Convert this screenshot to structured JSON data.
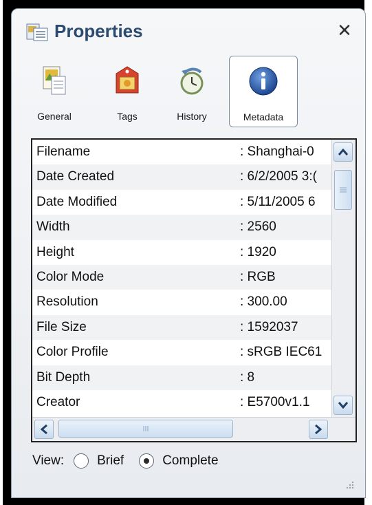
{
  "window": {
    "title": "Properties",
    "close_symbol": "✕"
  },
  "toolbar": {
    "tabs": [
      {
        "label": "General",
        "icon": "image-document-icon"
      },
      {
        "label": "Tags",
        "icon": "tag-picture-icon"
      },
      {
        "label": "History",
        "icon": "clock-history-icon"
      },
      {
        "label": "Metadata",
        "icon": "info-icon",
        "selected": true
      }
    ]
  },
  "metadata": {
    "rows": [
      {
        "key": "Filename",
        "value": ": Shanghai-0"
      },
      {
        "key": "Date Created",
        "value": ": 6/2/2005 3:("
      },
      {
        "key": "Date Modified",
        "value": ": 5/11/2005 6"
      },
      {
        "key": "Width",
        "value": ": 2560"
      },
      {
        "key": "Height",
        "value": ": 1920"
      },
      {
        "key": "Color Mode",
        "value": ": RGB"
      },
      {
        "key": "Resolution",
        "value": ": 300.00"
      },
      {
        "key": "File Size",
        "value": ": 1592037"
      },
      {
        "key": "Color Profile",
        "value": ": sRGB IEC61"
      },
      {
        "key": "Bit Depth",
        "value": ": 8"
      },
      {
        "key": "Creator",
        "value": ": E5700v1.1"
      }
    ]
  },
  "view": {
    "label": "View:",
    "options": [
      {
        "label": "Brief",
        "selected": false
      },
      {
        "label": "Complete",
        "selected": true
      }
    ]
  },
  "colors": {
    "title_text": "#2b4a70",
    "scroll_accent": "#1f3f66"
  }
}
